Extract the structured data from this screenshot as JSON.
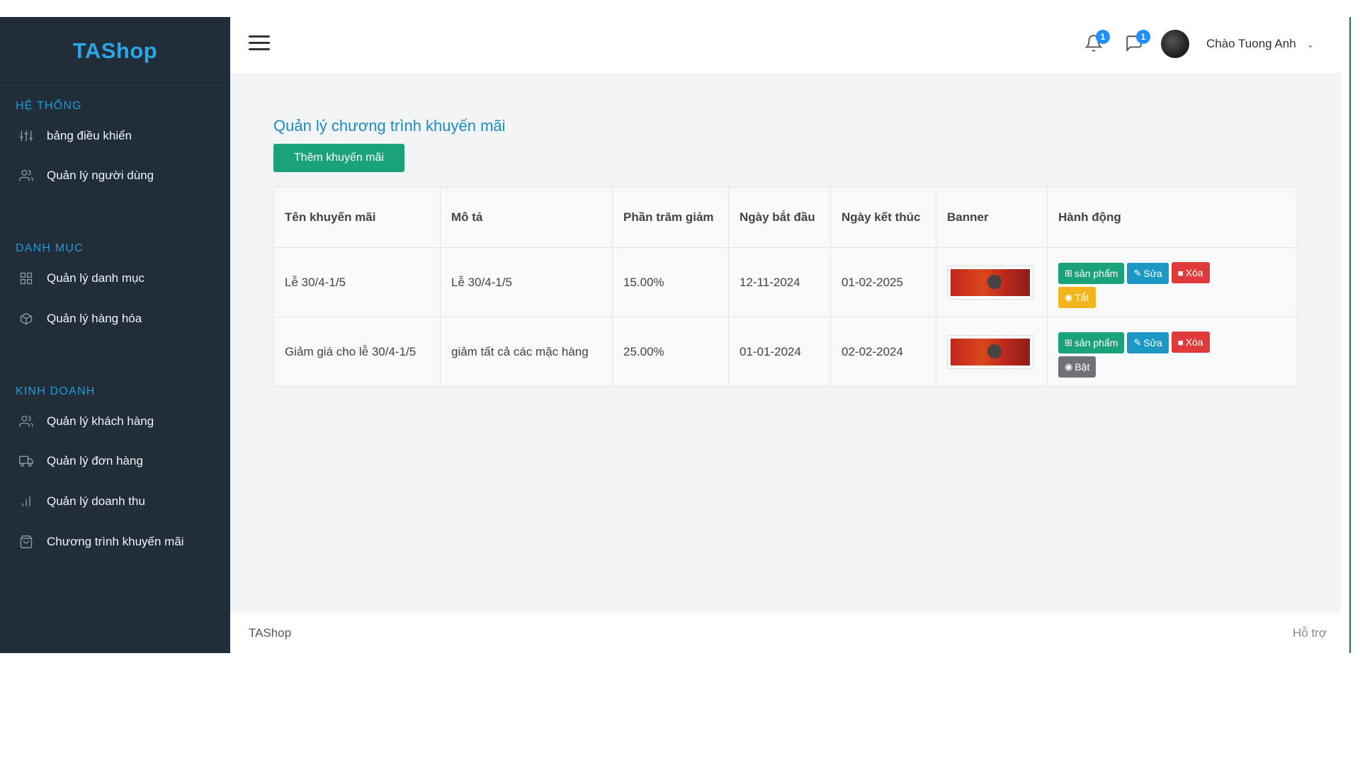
{
  "sidebar": {
    "brand": "TAShop",
    "sections": [
      {
        "title": "HỆ THỐNG",
        "items": [
          {
            "label": "bảng điều khiển",
            "icon": "sliders-icon"
          },
          {
            "label": "Quản lý người dùng",
            "icon": "users-icon"
          }
        ]
      },
      {
        "title": "DANH MỤC",
        "items": [
          {
            "label": "Quản lý danh mục",
            "icon": "grid-icon"
          },
          {
            "label": "Quản lý hàng hóa",
            "icon": "box-icon"
          }
        ]
      },
      {
        "title": "KINH DOANH",
        "items": [
          {
            "label": "Quản lý khách hàng",
            "icon": "users-icon"
          },
          {
            "label": "Quản lý đơn hàng",
            "icon": "truck-icon"
          },
          {
            "label": "Quản lý doanh thu",
            "icon": "bar-chart-icon"
          },
          {
            "label": "Chương trình khuyến mãi",
            "icon": "shopping-bag-icon"
          }
        ]
      }
    ]
  },
  "header": {
    "notifications_count": "1",
    "messages_count": "1",
    "greeting": "Chào Tuong Anh",
    "dropdown_icon": "chevron-down-icon"
  },
  "main": {
    "title": "Quản lý chương trình khuyến mãi",
    "add_button": "Thêm khuyến mãi",
    "table": {
      "columns": [
        "Tên khuyến mãi",
        "Mô tả",
        "Phần trăm giảm",
        "Ngày bắt đầu",
        "Ngày kết thúc",
        "Banner",
        "Hành động"
      ],
      "rows": [
        {
          "name": "Lễ 30/4-1/5",
          "description": "Lễ 30/4-1/5",
          "percent": "15.00%",
          "start": "12-11-2024",
          "end": "01-02-2025",
          "toggle_label": "Tắt",
          "toggle_state": "on"
        },
        {
          "name": "Giảm giá cho lễ 30/4-1/5",
          "description": "giảm tất cả các mặc hàng",
          "percent": "25.00%",
          "start": "01-01-2024",
          "end": "02-02-2024",
          "toggle_label": "Bật",
          "toggle_state": "off"
        }
      ],
      "actions": {
        "products": "sản phẩm",
        "edit": "Sửa",
        "delete": "Xóa"
      }
    }
  },
  "footer": {
    "brand": "TAShop",
    "help": "Hỗ trợ"
  },
  "colors": {
    "sidebar_bg": "#222d3a",
    "accent_blue": "#1a8dc4",
    "success_green": "#1aa37a",
    "danger_red": "#e03b3b",
    "warning_yellow": "#f3b51e",
    "info_blue": "#1d97c4"
  }
}
